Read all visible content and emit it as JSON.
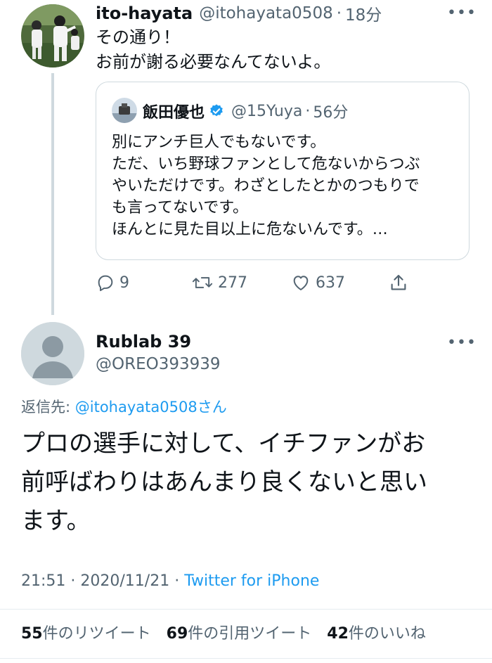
{
  "parent_tweet": {
    "display_name": "ito-hayata",
    "handle": "@itohayata0508",
    "separator": "·",
    "time": "18分",
    "more": "•••",
    "lines": [
      "その通り！",
      "お前が謝る必要なんてないよ。"
    ]
  },
  "quoted_tweet": {
    "display_name": "飯田優也",
    "verified": true,
    "handle": "@15Yuya",
    "separator": "·",
    "time": "56分",
    "lines": [
      "別にアンチ巨人でもないです。",
      "ただ、いち野球ファンとして危ないからつぶ",
      "やいただけです。わざとしたとかのつもりで",
      "も言ってないです。",
      "ほんとに見た目以上に危ないんです。…"
    ]
  },
  "actions": {
    "reply_count": "9",
    "retweet_count": "277",
    "like_count": "637"
  },
  "main_tweet": {
    "display_name": "Rublab 39",
    "handle": "@OREO393939",
    "more": "•••",
    "reply_to_label": "返信先: ",
    "reply_to_handle": "@itohayata0508",
    "reply_to_suffix": "さん",
    "lines": [
      "プロの選手に対して、イチファンがお",
      "前呼ばわりはあんまり良くないと思い",
      "ます。"
    ],
    "time": "21:51",
    "separator": " · ",
    "date": "2020/11/21",
    "source": "Twitter for iPhone"
  },
  "stats": {
    "retweets_count": "55",
    "retweets_label": "件のリツイート",
    "quotes_count": "69",
    "quotes_label": "件の引用ツイート",
    "likes_count": "42",
    "likes_label": "件のいいね"
  },
  "colors": {
    "accent": "#1d9bf0",
    "secondary_text": "#536471",
    "primary_text": "#0f1419",
    "border": "#cfd9de"
  }
}
